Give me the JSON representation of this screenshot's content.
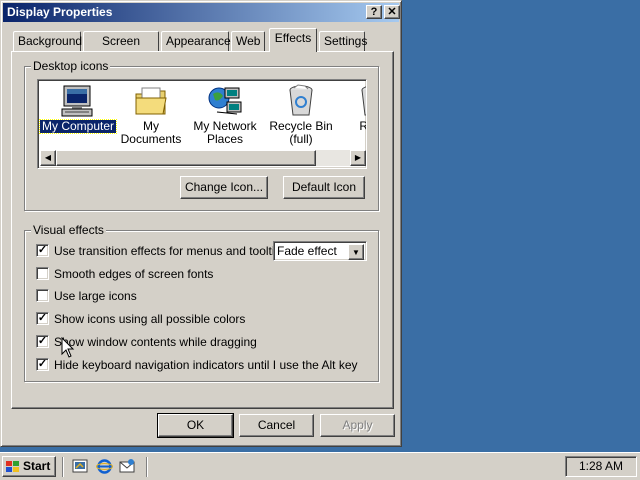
{
  "window": {
    "title": "Display Properties",
    "help_glyph": "?",
    "close_glyph": "✕"
  },
  "tabs": [
    {
      "label": "Background"
    },
    {
      "label": "Screen Saver"
    },
    {
      "label": "Appearance"
    },
    {
      "label": "Web"
    },
    {
      "label": "Effects",
      "active": true
    },
    {
      "label": "Settings"
    }
  ],
  "desktop_icons": {
    "group_label": "Desktop icons",
    "items": [
      {
        "label": "My Computer",
        "icon": "computer-icon",
        "selected": true
      },
      {
        "label": "My Documents",
        "icon": "folder-icon"
      },
      {
        "label": "My Network Places",
        "icon": "network-icon"
      },
      {
        "label": "Recycle Bin (full)",
        "icon": "recycle-bin-full-icon"
      },
      {
        "label": "Recy (e",
        "icon": "recycle-bin-empty-icon"
      }
    ],
    "change_icon_button": "Change Icon...",
    "default_icon_button": "Default Icon"
  },
  "visual_effects": {
    "group_label": "Visual effects",
    "options": [
      {
        "label": "Use transition effects for menus and tooltips",
        "checked": true
      },
      {
        "label": "Smooth edges of screen fonts",
        "checked": false
      },
      {
        "label": "Use large icons",
        "checked": false
      },
      {
        "label": "Show icons using all possible colors",
        "checked": true
      },
      {
        "label": "Show window contents while dragging",
        "checked": true
      },
      {
        "label": "Hide keyboard navigation indicators until I use the Alt key",
        "checked": true
      }
    ],
    "transition_effect_value": "Fade effect"
  },
  "dialog_buttons": {
    "ok": "OK",
    "cancel": "Cancel",
    "apply": "Apply"
  },
  "taskbar": {
    "start_label": "Start",
    "quick_launch": [
      "show-desktop-icon",
      "internet-explorer-icon",
      "outlook-express-icon"
    ],
    "clock": "1:28 AM"
  },
  "colors": {
    "desktop": "#3a6ea5",
    "titlebar_start": "#0a246a",
    "titlebar_end": "#a6caf0",
    "face": "#d4d0c8",
    "selection": "#0a246a"
  }
}
